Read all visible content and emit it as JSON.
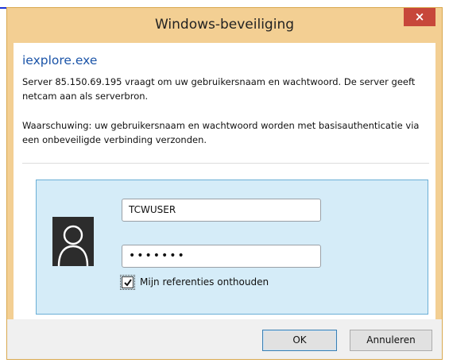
{
  "background": {
    "link_color": "#1a33d6"
  },
  "dialog": {
    "title": "Windows-beveiliging",
    "close_label": "×",
    "accent_color": "#f3cf93",
    "close_color": "#c7473a"
  },
  "content": {
    "app_name": "iexplore.exe",
    "message": "Server 85.150.69.195 vraagt om uw gebruikersnaam en wachtwoord. De server geeft netcam aan als serverbron.",
    "warning": "Waarschuwing: uw gebruikersnaam en wachtwoord worden met basisauthenticatie via een onbeveiligde verbinding verzonden."
  },
  "credentials": {
    "avatar_icon": "user-avatar-icon",
    "username_value": "TCWUSER",
    "password_value": "•••••••",
    "remember_label": "Mijn referenties onthouden",
    "remember_checked": true,
    "panel_color": "#d5ecf8"
  },
  "buttons": {
    "ok_label": "OK",
    "cancel_label": "Annuleren"
  }
}
